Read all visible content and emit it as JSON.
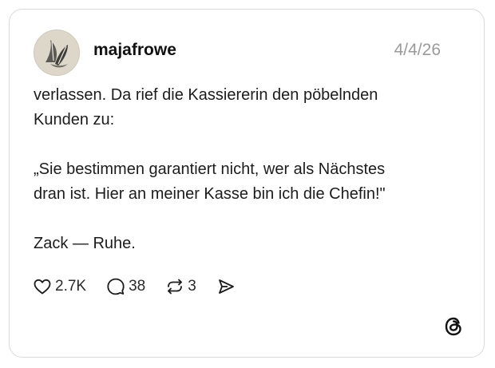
{
  "post": {
    "author": {
      "username": "majafrowe"
    },
    "date": "4/4/26",
    "paragraphs": [
      "verlassen. Da rief die Kassiererin den pöbelnden\nKunden zu:",
      "„Sie bestimmen garantiert nicht, wer als Nächstes\ndran ist. Hier an meiner Kasse bin ich die Chefin!\"",
      "Zack — Ruhe."
    ],
    "actions": {
      "likes": "2.7K",
      "replies": "38",
      "reposts": "3"
    }
  },
  "icons": {
    "like": "heart-icon",
    "reply": "speech-bubble-icon",
    "repost": "repost-icon",
    "share": "send-icon",
    "brand": "threads-logo-icon"
  },
  "colors": {
    "border": "#d9d9d9",
    "text": "#1c1c1c",
    "muted": "#9a9a9a"
  }
}
